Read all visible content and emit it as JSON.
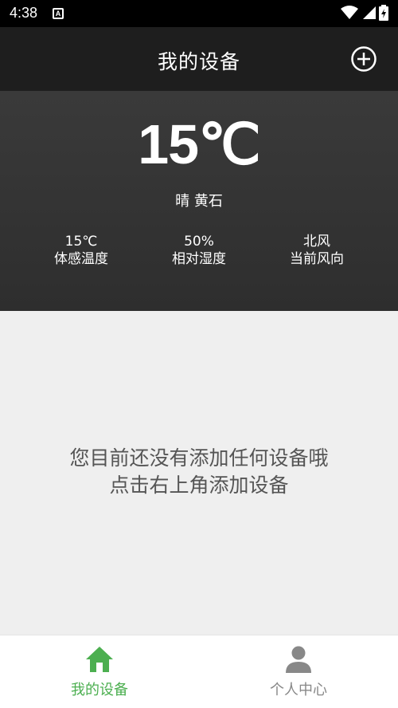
{
  "status_bar": {
    "time": "4:38",
    "app_icon_letter": "A"
  },
  "header": {
    "title": "我的设备"
  },
  "weather": {
    "temperature": "15℃",
    "description": "晴 黄石",
    "stats": [
      {
        "value": "15℃",
        "label": "体感温度"
      },
      {
        "value": "50%",
        "label": "相对湿度"
      },
      {
        "value": "北风",
        "label": "当前风向"
      }
    ]
  },
  "empty_state": {
    "line1": "您目前还没有添加任何设备哦",
    "line2": "点击右上角添加设备"
  },
  "bottom_nav": {
    "items": [
      {
        "label": "我的设备",
        "icon": "home-icon",
        "active": true
      },
      {
        "label": "个人中心",
        "icon": "person-icon",
        "active": false
      }
    ]
  },
  "colors": {
    "active": "#4caf50",
    "inactive": "#888888",
    "header_bg": "#1e1e1e",
    "content_bg": "#efefef"
  }
}
